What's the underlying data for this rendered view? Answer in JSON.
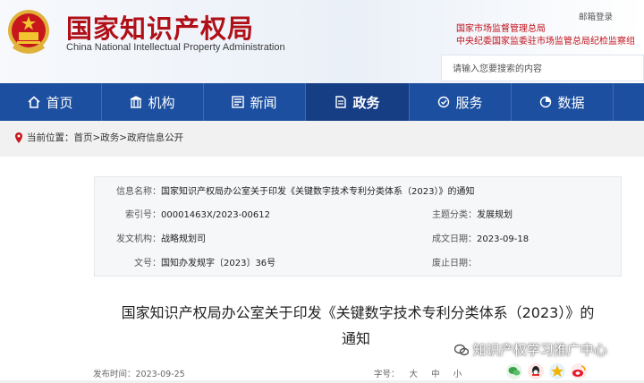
{
  "site": {
    "title": "国家知识产权局",
    "subtitle": "China National Intellectual Property Administration"
  },
  "header": {
    "mail_login": "邮箱登录",
    "related_links": [
      "国家市场监督管理总局",
      "中央纪委国家监委驻市场监管总局纪检监察组"
    ],
    "search_placeholder": "请输入您要搜索的内容"
  },
  "nav": [
    {
      "label": "首页",
      "icon": "home-icon"
    },
    {
      "label": "机构",
      "icon": "building-icon"
    },
    {
      "label": "新闻",
      "icon": "newspaper-icon"
    },
    {
      "label": "政务",
      "icon": "document-icon",
      "active": true
    },
    {
      "label": "服务",
      "icon": "service-icon"
    },
    {
      "label": "数据",
      "icon": "data-icon"
    }
  ],
  "breadcrumb": {
    "prefix": "当前位置：",
    "path": "首页>政务>政府信息公开"
  },
  "meta": {
    "info_name_label": "信息名称：",
    "info_name": "国家知识产权局办公室关于印发《关键数字技术专利分类体系（2023）》的通知",
    "index_label": "索引号：",
    "index": "00001463X/2023-00612",
    "topic_label": "主题分类：",
    "topic": "发展规划",
    "org_label": "发文机构：",
    "org": "战略规划司",
    "date_label": "成文日期：",
    "date": "2023-09-18",
    "docno_label": "文号：",
    "docno": "国知办发规字〔2023〕36号",
    "expire_label": "废止日期："
  },
  "article": {
    "title_line1": "国家知识产权局办公室关于印发《关键数字技术专利分类体系（2023）》的",
    "title_line2": "通知",
    "publish_time": "发布时间：2023-09-25",
    "font_size_label": "字号：",
    "font_sizes": [
      "大",
      "中",
      "小"
    ]
  },
  "watermark": "知识产权学习推广中心",
  "colors": {
    "brand_red": "#b01018",
    "nav_blue": "#1c4fa0",
    "nav_active": "#163e85"
  }
}
